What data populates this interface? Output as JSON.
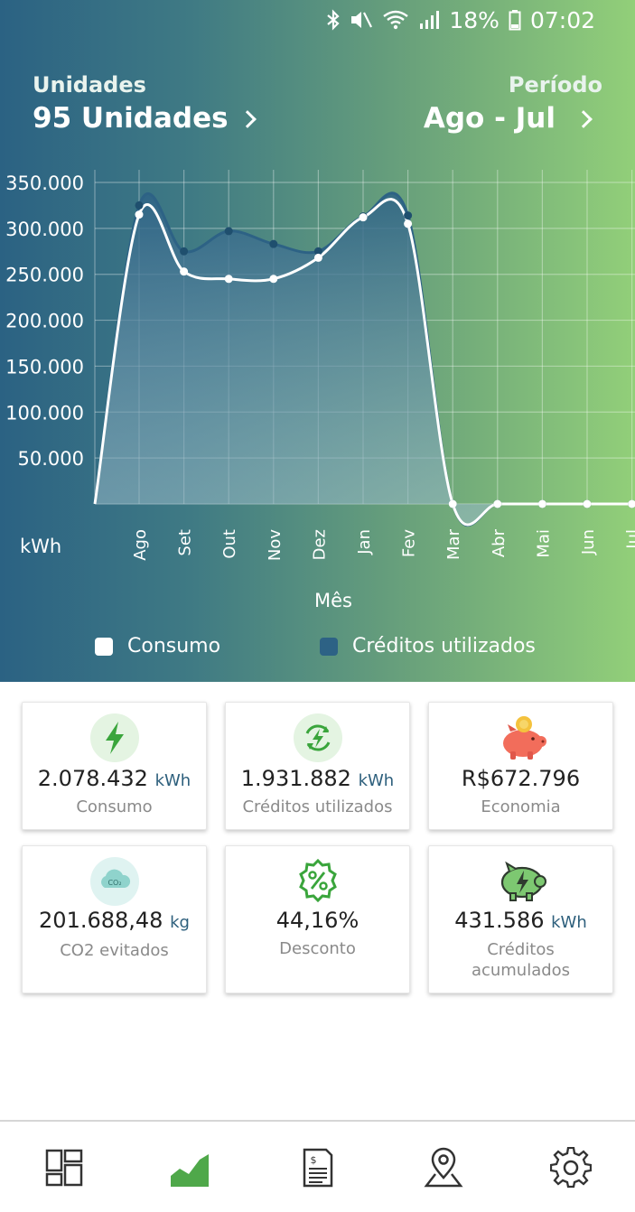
{
  "status_bar": {
    "battery": "18%",
    "time": "07:02"
  },
  "header": {
    "units_label": "Unidades",
    "units_value": "95 Unidades",
    "period_label": "Período",
    "period_value": "Ago - Jul"
  },
  "chart_data": {
    "type": "area",
    "categories": [
      "Ago",
      "Set",
      "Out",
      "Nov",
      "Dez",
      "Jan",
      "Fev",
      "Mar",
      "Abr",
      "Mai",
      "Jun",
      "Jul"
    ],
    "series": [
      {
        "name": "Consumo",
        "values": [
          315000,
          253000,
          245000,
          245000,
          268000,
          312000,
          305000,
          0,
          0,
          0,
          0,
          0
        ]
      },
      {
        "name": "Créditos utilizados",
        "values": [
          325000,
          275000,
          297000,
          283000,
          275000,
          313000,
          314000,
          0,
          0,
          0,
          0,
          0
        ]
      }
    ],
    "y_ticks": [
      "350.000",
      "300.000",
      "250.000",
      "200.000",
      "150.000",
      "100.000",
      "50.000"
    ],
    "ylim": [
      0,
      350000
    ],
    "ylabel": "kWh",
    "xlabel": "Mês",
    "grid": true,
    "legend_placement": "bottom",
    "colors": {
      "Consumo": "#ffffff",
      "Créditos utilizados": "#2d6285"
    }
  },
  "cards": [
    {
      "value": "2.078.432",
      "unit": "kWh",
      "label": "Consumo",
      "icon": "lightning-icon"
    },
    {
      "value": "1.931.882",
      "unit": "kWh",
      "label": "Créditos utilizados",
      "icon": "recycle-energy-icon"
    },
    {
      "value": "R$672.796",
      "unit": "",
      "label": "Economia",
      "icon": "piggy-bank-coin-icon"
    },
    {
      "value": "201.688,48",
      "unit": "kg",
      "label": "CO2 evitados",
      "icon": "co2-cloud-icon"
    },
    {
      "value": "44,16%",
      "unit": "",
      "label": "Desconto",
      "icon": "percent-badge-icon"
    },
    {
      "value": "431.586",
      "unit": "kWh",
      "label_line1": "Créditos",
      "label_line2": "acumulados",
      "icon": "energy-piggy-icon"
    }
  ],
  "colors": {
    "accent_green": "#4fa84a",
    "navy": "#2d5f7c"
  }
}
